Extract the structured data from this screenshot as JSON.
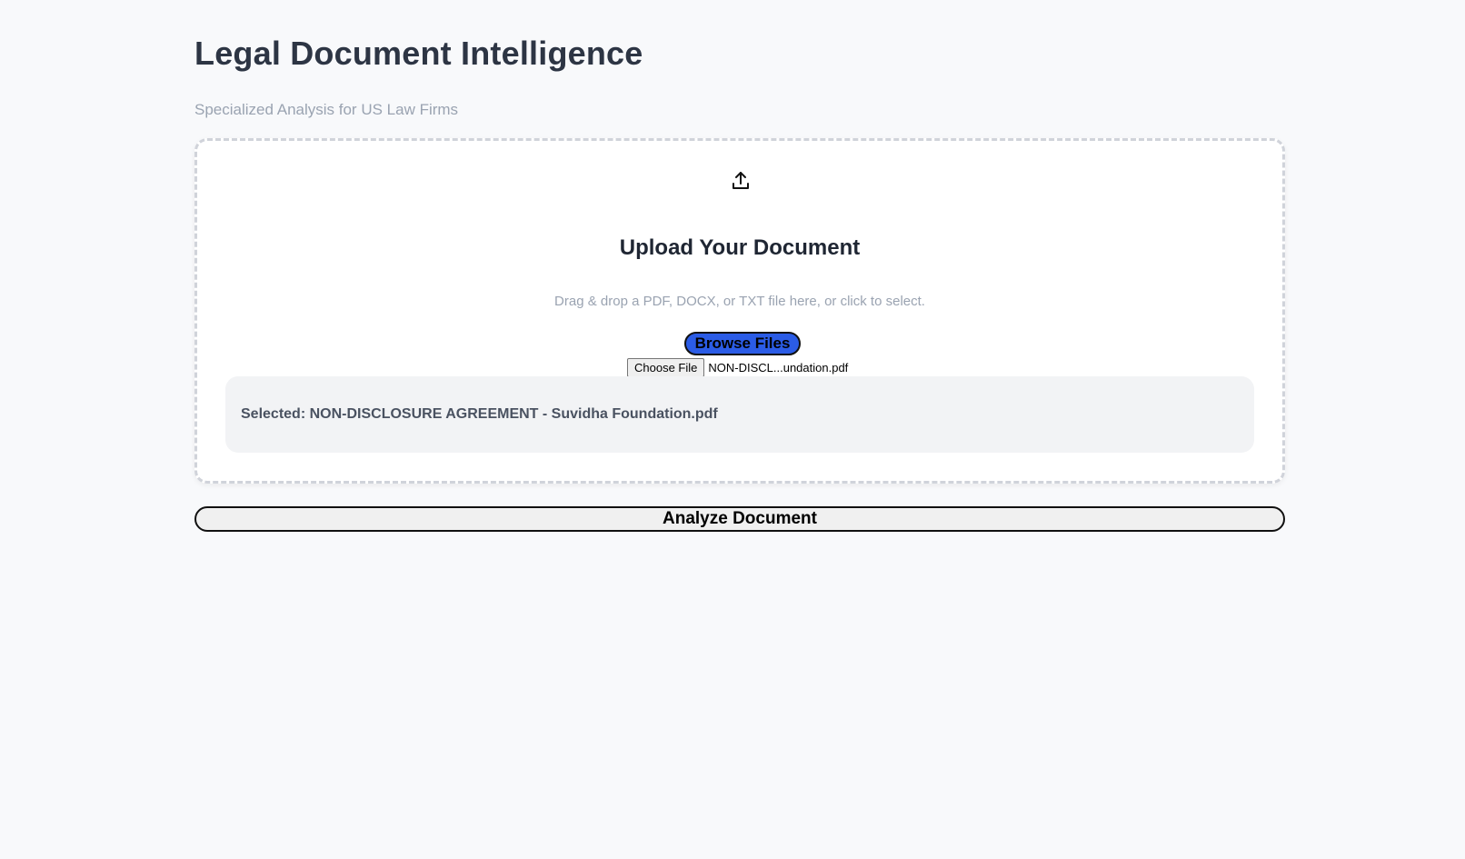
{
  "header": {
    "title": "Legal Document Intelligence",
    "subtitle": "Specialized Analysis for US Law Firms"
  },
  "upload": {
    "icon": "upload-icon",
    "heading": "Upload Your Document",
    "hint": "Drag & drop a PDF, DOCX, or TXT file here, or click to select.",
    "browse_label": "Browse Files",
    "choose_file_label": "Choose File",
    "chosen_file_display": "NON-DISCL...undation.pdf",
    "selected_text": "Selected: NON-DISCLOSURE AGREEMENT - Suvidha Foundation.pdf"
  },
  "actions": {
    "analyze_label": "Analyze Document"
  },
  "colors": {
    "background": "#f8f9fb",
    "accent": "#2b5ce6",
    "title": "#2d3544",
    "muted": "#9aa3b1"
  }
}
